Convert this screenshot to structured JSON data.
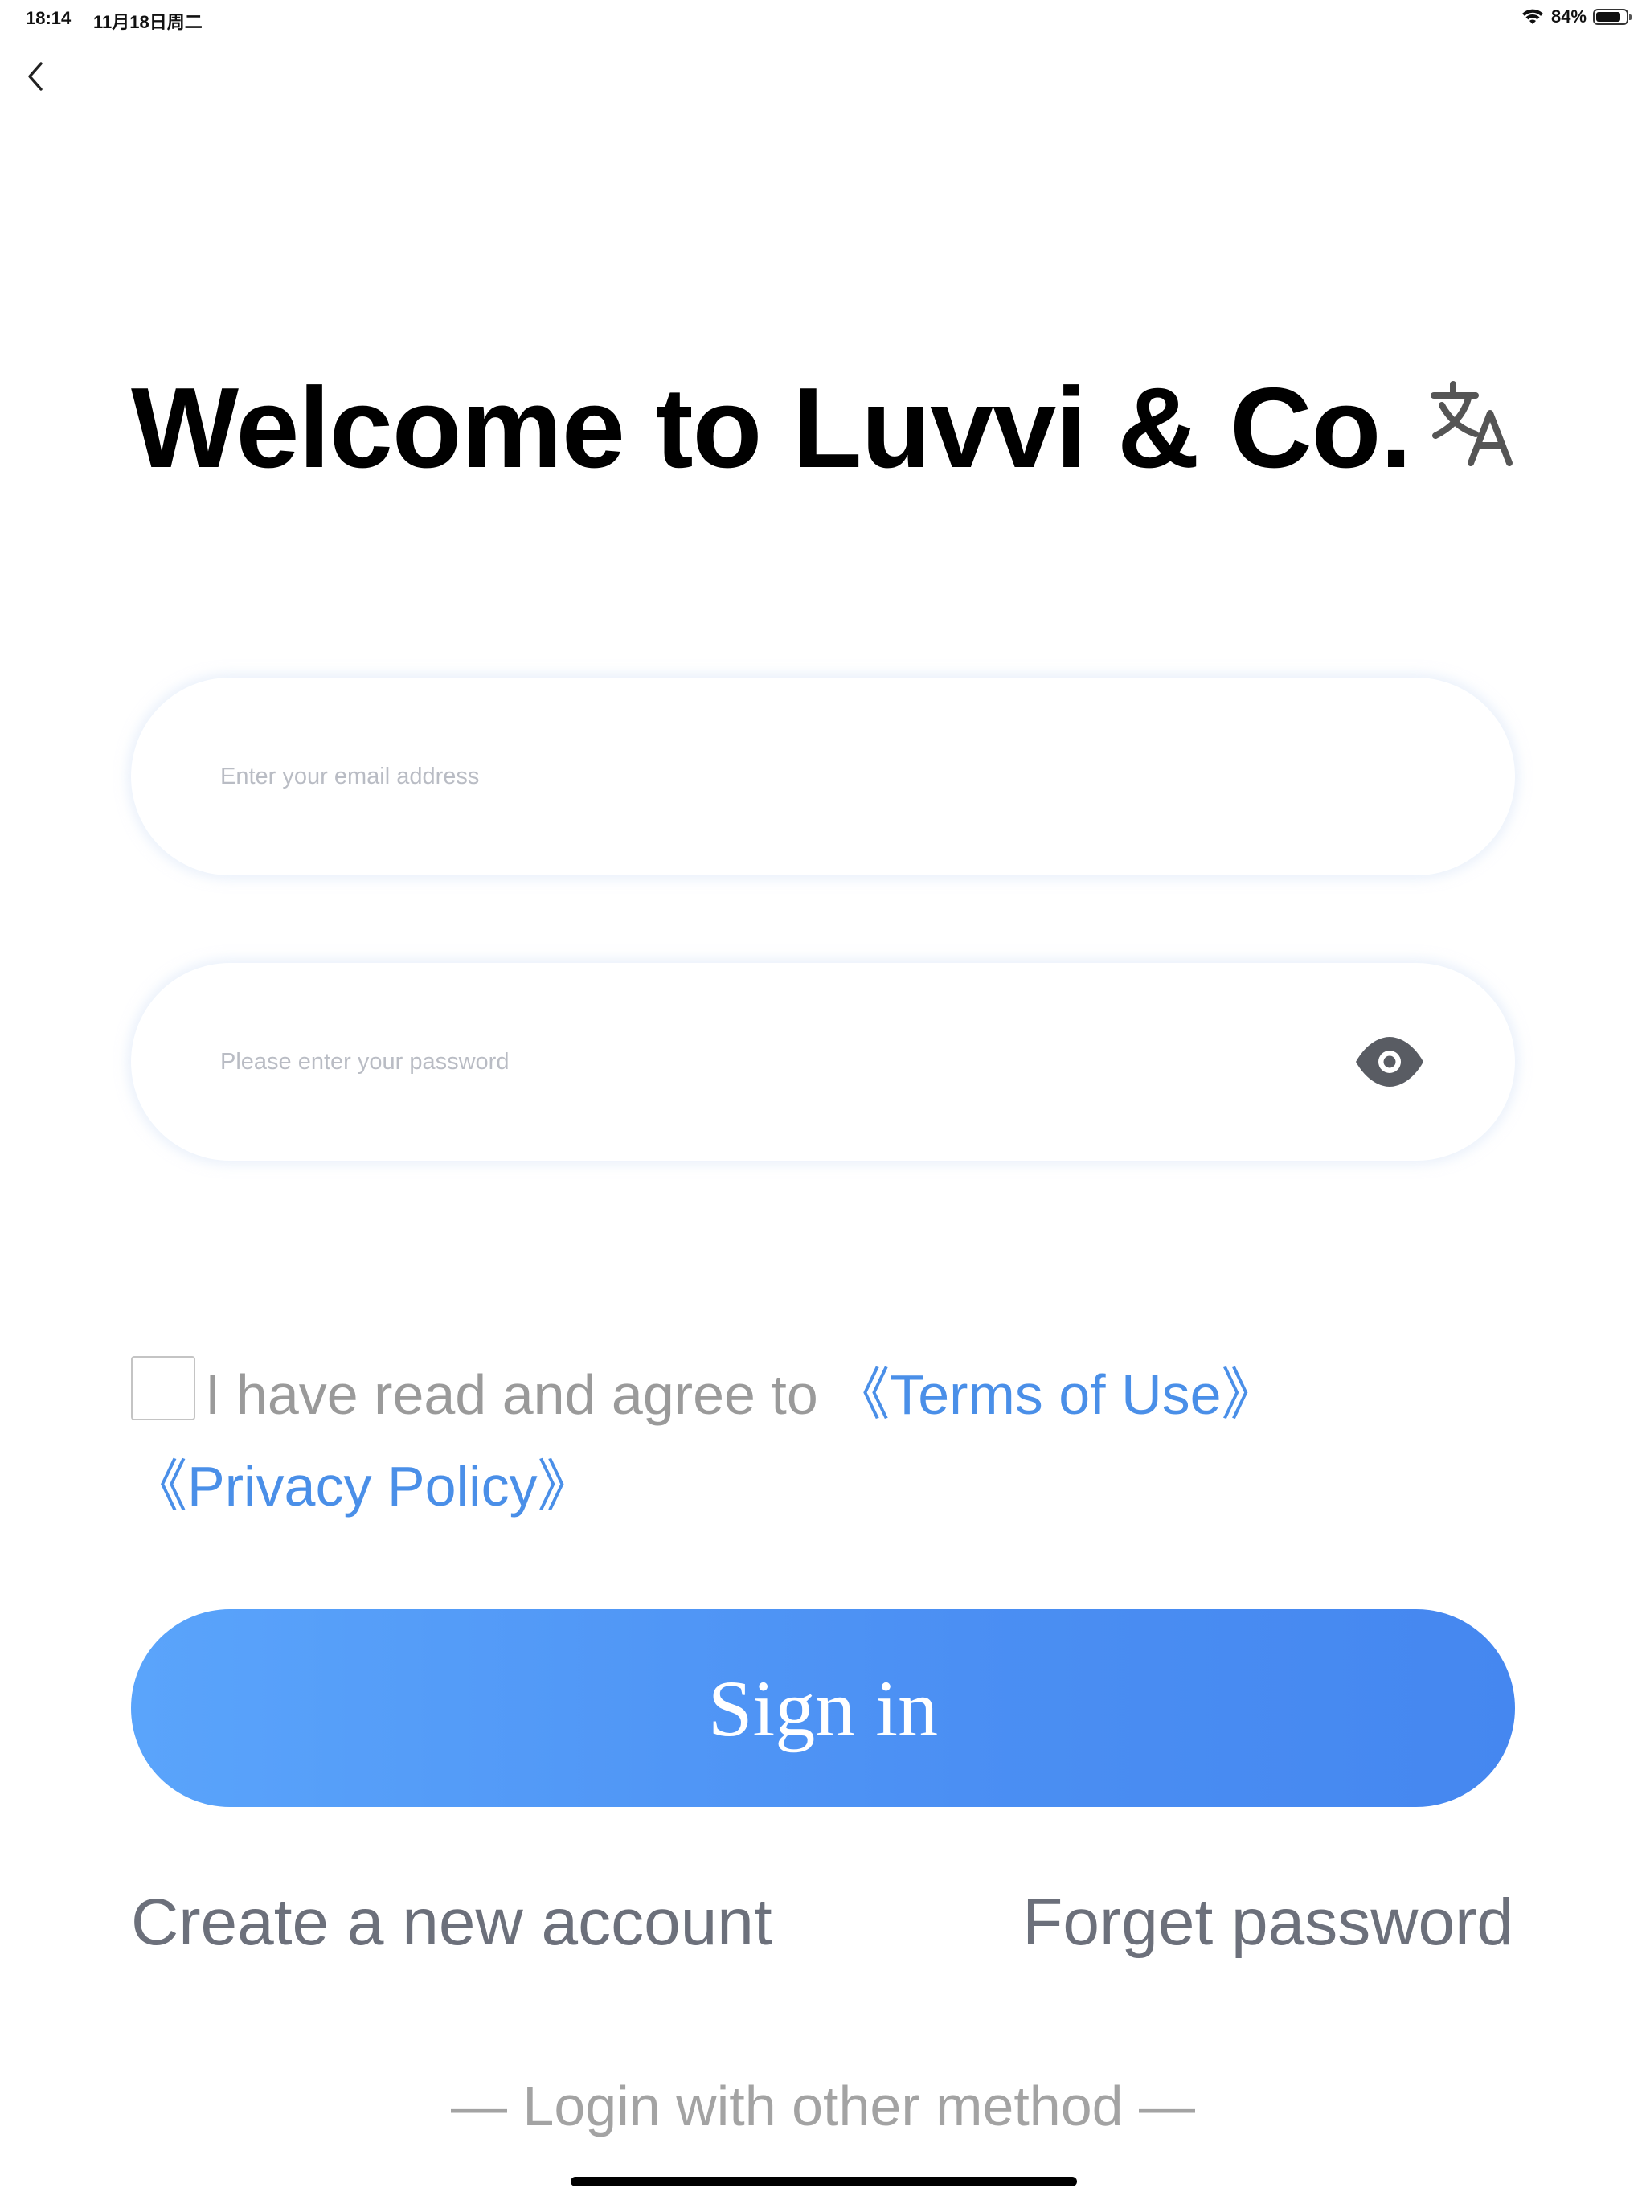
{
  "status_bar": {
    "time": "18:14",
    "date": "11月18日周二",
    "battery_text": "84%",
    "battery_level": 0.84
  },
  "header": {
    "title": "Welcome to Luvvi & Co."
  },
  "form": {
    "email_placeholder": "Enter your email address",
    "password_placeholder": "Please enter your password"
  },
  "agreement": {
    "prefix": "I have read and agree to ",
    "terms_label": "《Terms of Use》",
    "privacy_label": "《Privacy Policy》",
    "checked": false
  },
  "actions": {
    "sign_in_label": "Sign in",
    "create_account_label": "Create a new account",
    "forgot_password_label": "Forget password",
    "other_method_label": "— Login with other method —"
  },
  "colors": {
    "accent": "#4a8fe8",
    "button_gradient_start": "#5aa4fb",
    "button_gradient_end": "#4587f0",
    "secondary_text": "#6c707b"
  },
  "icons": {
    "back": "chevron-left-icon",
    "translate": "translate-icon",
    "password_toggle": "eye-icon",
    "wifi": "wifi-icon",
    "battery": "battery-icon"
  }
}
